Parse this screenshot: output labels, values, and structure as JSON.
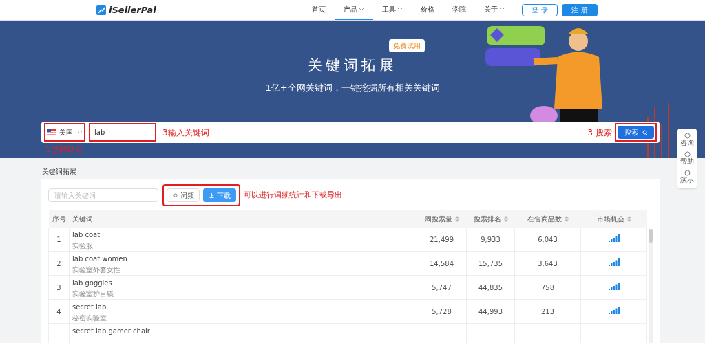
{
  "nav": {
    "logo": "iSellerPal",
    "links": [
      {
        "label": "首页",
        "selected": false,
        "dropdown": false
      },
      {
        "label": "产品",
        "selected": true,
        "dropdown": true
      },
      {
        "label": "工具",
        "selected": false,
        "dropdown": true
      },
      {
        "label": "价格",
        "selected": false,
        "dropdown": false
      },
      {
        "label": "学院",
        "selected": false,
        "dropdown": false
      },
      {
        "label": "关于",
        "selected": false,
        "dropdown": true
      }
    ],
    "login": "登 录",
    "register": "注 册"
  },
  "hero": {
    "badge": "免费试用",
    "title": "关键词拓展",
    "subtitle": "1亿+全网关键词，一键挖掘所有相关关键词"
  },
  "search": {
    "country": "美国",
    "value": "lab",
    "button": "搜索"
  },
  "annotations": {
    "site": "1 选择站点",
    "keyword": "3输入关键词",
    "search": "3 搜索",
    "tools": "可以进行词频统计和下载导出"
  },
  "side_widget": [
    "咨询",
    "帮助",
    "演示"
  ],
  "section_title": "关键词拓展",
  "filter": {
    "placeholder": "请输入关键词",
    "freq_button": "词频",
    "download_button": "下载"
  },
  "table": {
    "columns": [
      "序号",
      "关键词",
      "周搜索量",
      "搜索排名",
      "在售商品数",
      "市场机会"
    ],
    "rows": [
      {
        "index": "1",
        "keyword": "lab coat",
        "translation": "实验服",
        "weekly": "21,499",
        "rank": "9,933",
        "products": "6,043"
      },
      {
        "index": "2",
        "keyword": "lab coat women",
        "translation": "实验室外套女性",
        "weekly": "14,584",
        "rank": "15,735",
        "products": "3,643"
      },
      {
        "index": "3",
        "keyword": "lab goggles",
        "translation": "实验室护目镜",
        "weekly": "5,747",
        "rank": "44,835",
        "products": "758"
      },
      {
        "index": "4",
        "keyword": "secret lab",
        "translation": "秘密实验室",
        "weekly": "5,728",
        "rank": "44,993",
        "products": "213"
      },
      {
        "keyword": "secret lab gamer chair"
      }
    ]
  }
}
